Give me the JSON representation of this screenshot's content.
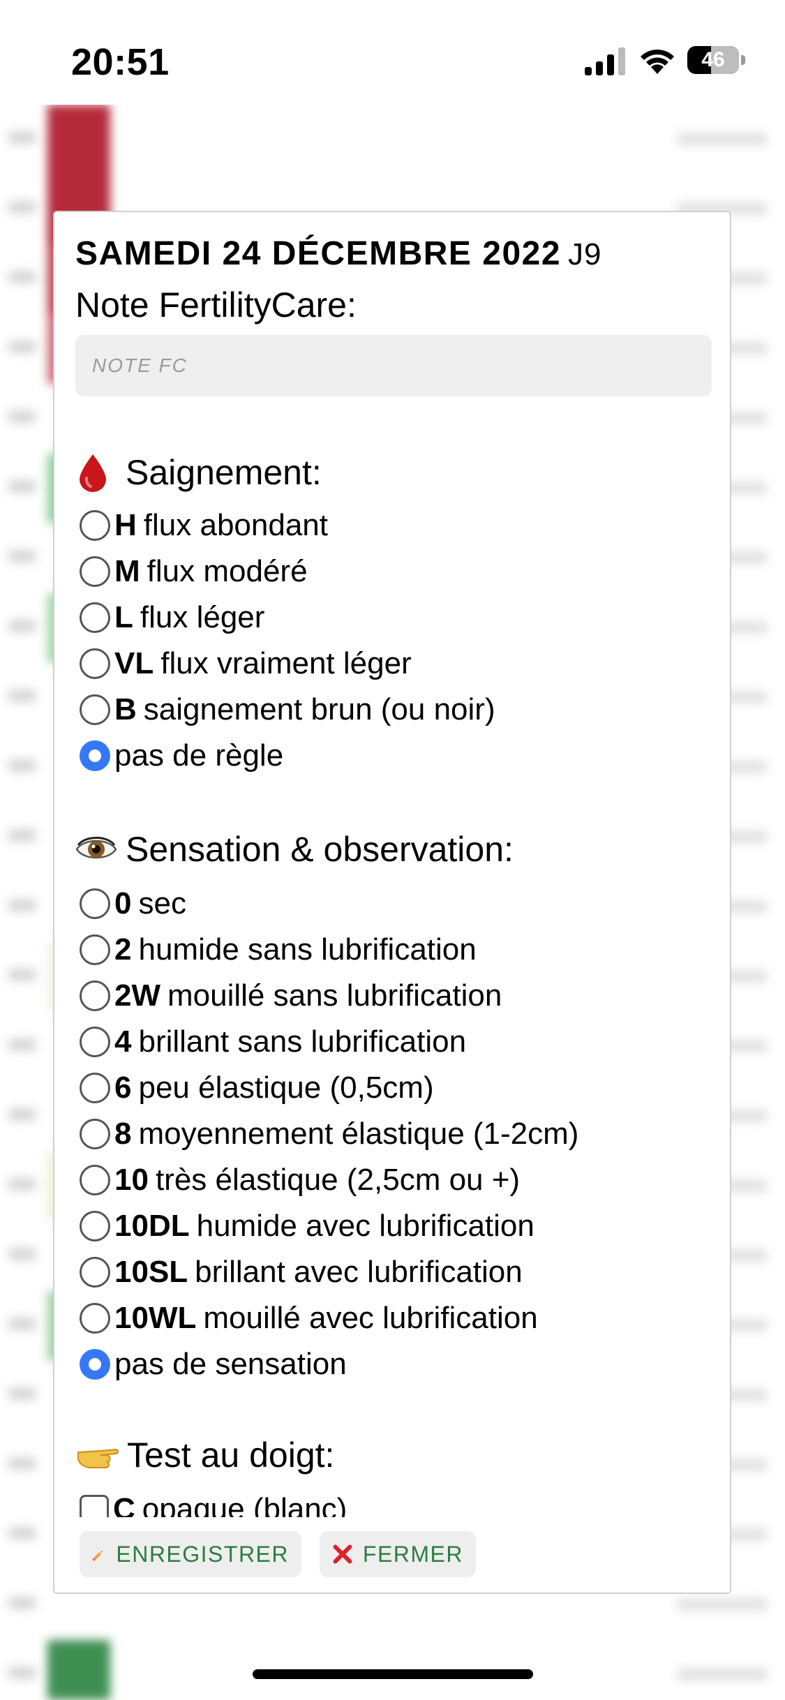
{
  "status_bar": {
    "time": "20:51",
    "battery_level": "46",
    "battery_fraction": 0.46
  },
  "modal": {
    "date": "SAMEDI 24 DÉCEMBRE 2022",
    "day_label": "J9",
    "note_label": "Note FertilityCare:",
    "note_placeholder": "NOTE FC",
    "note_value": "",
    "sections": {
      "bleeding": {
        "title": "Saignement:",
        "icon": "blood-drop-icon",
        "options": [
          {
            "code": "H",
            "label": "flux abondant",
            "selected": false
          },
          {
            "code": "M",
            "label": "flux modéré",
            "selected": false
          },
          {
            "code": "L",
            "label": "flux léger",
            "selected": false
          },
          {
            "code": "VL",
            "label": "flux vraiment léger",
            "selected": false
          },
          {
            "code": "B",
            "label": "saignement brun (ou noir)",
            "selected": false
          },
          {
            "code": "",
            "label": "pas de règle",
            "selected": true
          }
        ]
      },
      "sensation": {
        "title": "Sensation & observation:",
        "icon": "eye-icon",
        "options": [
          {
            "code": "0",
            "label": "sec",
            "selected": false
          },
          {
            "code": "2",
            "label": "humide sans lubrification",
            "selected": false
          },
          {
            "code": "2W",
            "label": "mouillé sans lubrification",
            "selected": false
          },
          {
            "code": "4",
            "label": "brillant sans lubrification",
            "selected": false
          },
          {
            "code": "6",
            "label": "peu élastique (0,5cm)",
            "selected": false
          },
          {
            "code": "8",
            "label": "moyennement élastique (1-2cm)",
            "selected": false
          },
          {
            "code": "10",
            "label": "très élastique (2,5cm ou +)",
            "selected": false
          },
          {
            "code": "10DL",
            "label": "humide avec lubrification",
            "selected": false
          },
          {
            "code": "10SL",
            "label": "brillant avec lubrification",
            "selected": false
          },
          {
            "code": "10WL",
            "label": "mouillé avec lubrification",
            "selected": false
          },
          {
            "code": "",
            "label": "pas de sensation",
            "selected": true
          }
        ]
      },
      "finger_test": {
        "title": "Test au doigt:",
        "icon": "pointing-hand-icon",
        "options": [
          {
            "code": "C",
            "label": "opaque (blanc)",
            "checked": false
          }
        ]
      }
    },
    "buttons": {
      "save": {
        "label": "ENREGISTRER",
        "icon": "pencil-icon"
      },
      "close": {
        "label": "FERMER",
        "icon": "red-cross-icon"
      }
    }
  },
  "colors": {
    "accent": "#3478f6",
    "button_text": "#2e7d3f",
    "button_bg": "#eeeeee"
  }
}
